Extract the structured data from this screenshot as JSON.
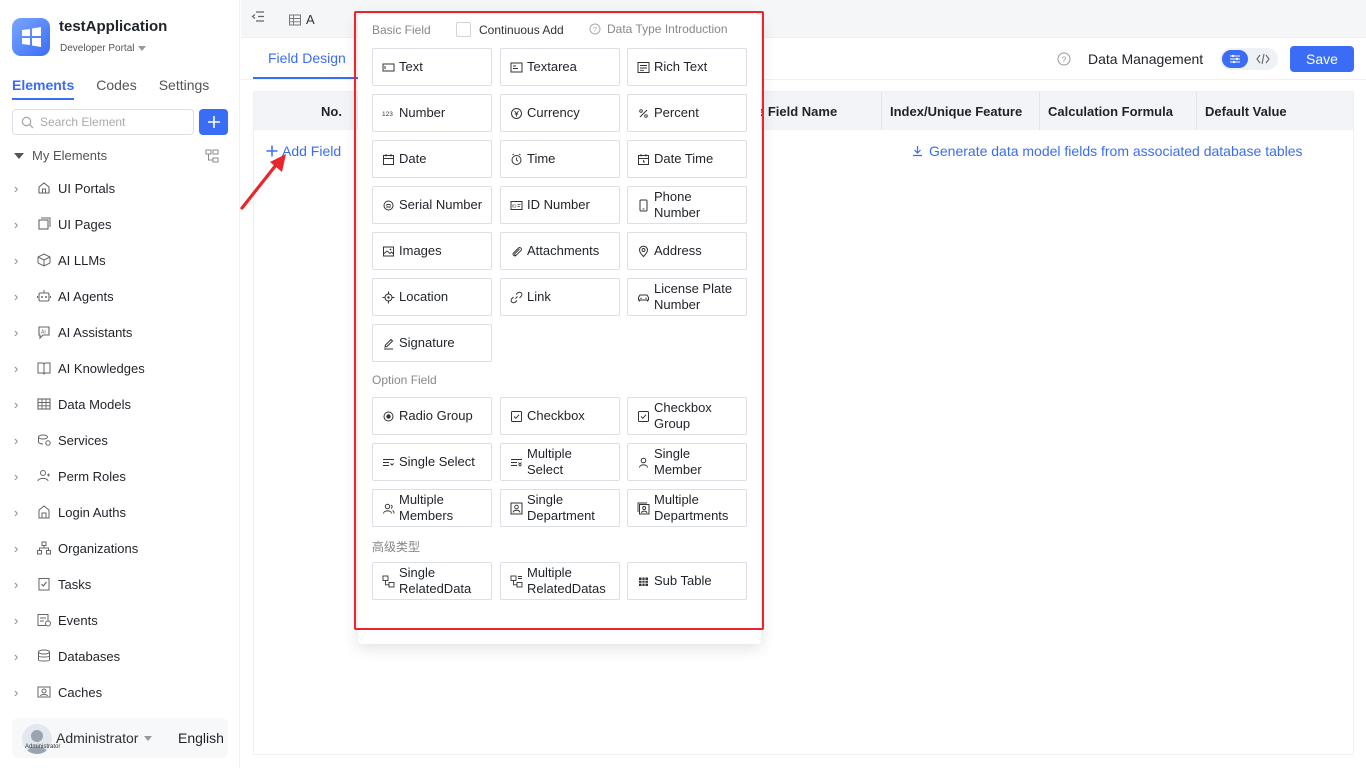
{
  "app": {
    "title": "testApplication",
    "portal": "Developer Portal"
  },
  "sidebar": {
    "tabs": [
      {
        "label": "Elements"
      },
      {
        "label": "Codes"
      },
      {
        "label": "Settings"
      }
    ],
    "search_placeholder": "Search Element",
    "my_elements": "My Elements",
    "items": [
      {
        "label": "UI Portals",
        "icon": "home-icon"
      },
      {
        "label": "UI Pages",
        "icon": "pages-icon"
      },
      {
        "label": "AI LLMs",
        "icon": "cube-icon"
      },
      {
        "label": "AI Agents",
        "icon": "robot-icon"
      },
      {
        "label": "AI Assistants",
        "icon": "ai-assistant-icon"
      },
      {
        "label": "AI Knowledges",
        "icon": "book-icon"
      },
      {
        "label": "Data Models",
        "icon": "table-icon"
      },
      {
        "label": "Services",
        "icon": "services-icon"
      },
      {
        "label": "Perm Roles",
        "icon": "roles-icon"
      },
      {
        "label": "Login Auths",
        "icon": "login-icon"
      },
      {
        "label": "Organizations",
        "icon": "org-icon"
      },
      {
        "label": "Tasks",
        "icon": "task-icon"
      },
      {
        "label": "Events",
        "icon": "events-icon"
      },
      {
        "label": "Databases",
        "icon": "database-icon"
      },
      {
        "label": "Caches",
        "icon": "cache-icon"
      }
    ],
    "user": {
      "name": "Administrator",
      "avatar_caption": "Administrator"
    },
    "language": "English"
  },
  "topbar": {
    "tab_label": "A"
  },
  "subbar": {
    "active_tab": "Field Design",
    "data_management": "Data Management",
    "save_label": "Save"
  },
  "table": {
    "headers": [
      {
        "label": "No."
      },
      {
        "label": "e Field Name"
      },
      {
        "label": "Index/Unique Feature"
      },
      {
        "label": "Calculation Formula"
      },
      {
        "label": "Default Value"
      }
    ],
    "add_field": "Add Field",
    "generate": "Generate data model fields from associated database tables"
  },
  "popup": {
    "basic_title": "Basic Field",
    "continuous_add": "Continuous Add",
    "data_type_intro": "Data Type Introduction",
    "option_title": "Option Field",
    "advanced_title": "高级类型",
    "basic_fields": [
      {
        "label": "Text",
        "icon": "text-icon"
      },
      {
        "label": "Textarea",
        "icon": "textarea-icon"
      },
      {
        "label": "Rich Text",
        "icon": "rich-text-icon"
      },
      {
        "label": "Number",
        "icon": "number-icon"
      },
      {
        "label": "Currency",
        "icon": "currency-icon"
      },
      {
        "label": "Percent",
        "icon": "percent-icon"
      },
      {
        "label": "Date",
        "icon": "date-icon"
      },
      {
        "label": "Time",
        "icon": "time-icon"
      },
      {
        "label": "Date Time",
        "icon": "datetime-icon"
      },
      {
        "label": "Serial Number",
        "icon": "serial-icon"
      },
      {
        "label": "ID Number",
        "icon": "id-card-icon"
      },
      {
        "label": "Phone Number",
        "icon": "phone-icon"
      },
      {
        "label": "Images",
        "icon": "image-icon"
      },
      {
        "label": "Attachments",
        "icon": "attachment-icon"
      },
      {
        "label": "Address",
        "icon": "address-icon"
      },
      {
        "label": "Location",
        "icon": "location-icon"
      },
      {
        "label": "Link",
        "icon": "link-icon"
      },
      {
        "label": "License Plate Number",
        "icon": "car-icon"
      },
      {
        "label": "Signature",
        "icon": "signature-icon"
      }
    ],
    "option_fields": [
      {
        "label": "Radio Group",
        "icon": "radio-icon"
      },
      {
        "label": "Checkbox",
        "icon": "checkbox-icon"
      },
      {
        "label": "Checkbox Group",
        "icon": "checkbox-group-icon"
      },
      {
        "label": "Single Select",
        "icon": "single-select-icon"
      },
      {
        "label": "Multiple Select",
        "icon": "multiple-select-icon"
      },
      {
        "label": "Single Member",
        "icon": "member-icon"
      },
      {
        "label": "Multiple Members",
        "icon": "members-icon"
      },
      {
        "label": "Single Department",
        "icon": "department-icon"
      },
      {
        "label": "Multiple Departments",
        "icon": "departments-icon"
      }
    ],
    "advanced_fields": [
      {
        "label": "Single RelatedData",
        "icon": "related-data-icon"
      },
      {
        "label": "Multiple RelatedDatas",
        "icon": "related-datas-icon"
      },
      {
        "label": "Sub Table",
        "icon": "sub-table-icon"
      }
    ]
  },
  "colors": {
    "accent": "#3b6cf6",
    "highlight": "#e8262b"
  }
}
